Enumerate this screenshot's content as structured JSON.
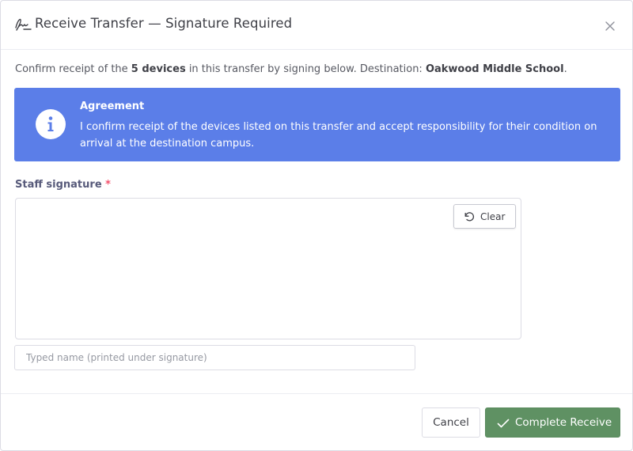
{
  "dialog": {
    "title": "Receive Transfer — Signature Required",
    "header_icon": "signature-icon",
    "close_icon": "close-icon"
  },
  "intro": {
    "prefix": "Confirm receipt of the ",
    "device_count": "5 devices",
    "middle": " in this transfer by signing below. Destination: ",
    "destination": "Oakwood Middle School",
    "suffix": "."
  },
  "alert": {
    "icon": "info-icon",
    "title": "Agreement",
    "text": "I confirm receipt of the devices listed on this transfer and accept responsibility for their condition on arrival at the destination campus.",
    "color": "#5b7ee8"
  },
  "signature": {
    "label": "Staff signature",
    "required_mark": "*",
    "clear_label": "Clear",
    "clear_icon": "undo-icon"
  },
  "typed_name": {
    "value": "",
    "placeholder": "Typed name (printed under signature)"
  },
  "footer": {
    "cancel_label": "Cancel",
    "complete_label": "Complete Receive",
    "complete_icon": "check-icon",
    "complete_color": "#5f9163"
  }
}
